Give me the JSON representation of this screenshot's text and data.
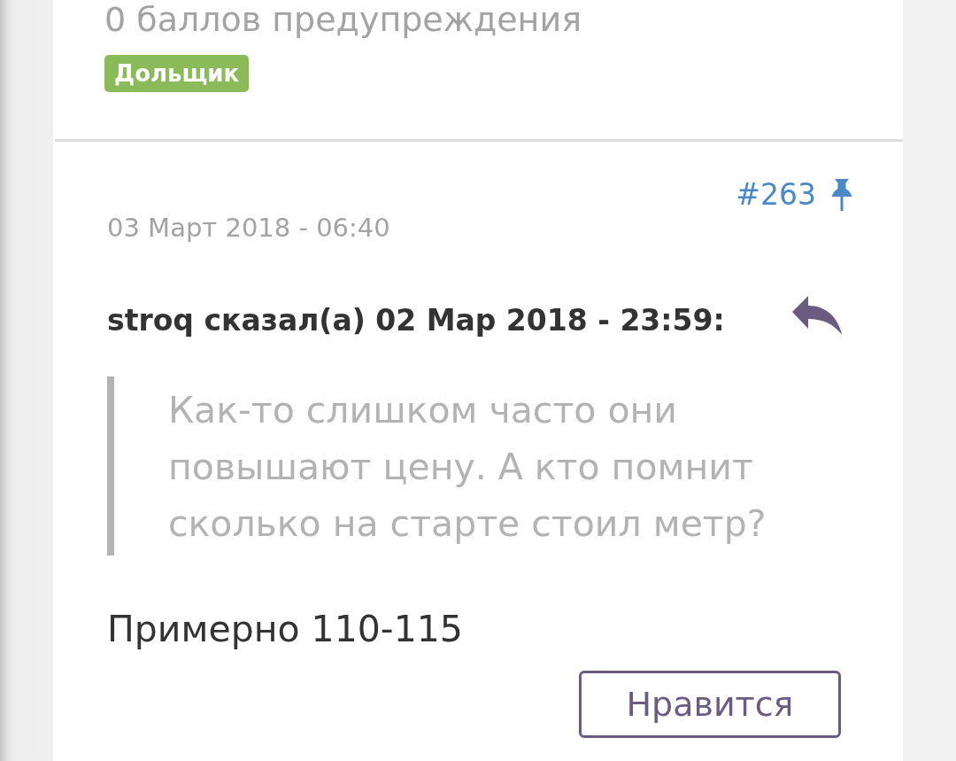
{
  "profile": {
    "warning_points": "0 баллов предупреждения",
    "group_badge": "Дольщик"
  },
  "post": {
    "number": "#263",
    "pinned": true,
    "date": "03 Март 2018 - 06:40",
    "quote": {
      "header": "stroq сказал(а) 02 Мар 2018 - 23:59:",
      "text": "Как-то слишком часто они повышают цену. А кто помнит сколько на старте стоил метр?"
    },
    "body": "Примерно 110-115",
    "like_button": "Нравится"
  }
}
